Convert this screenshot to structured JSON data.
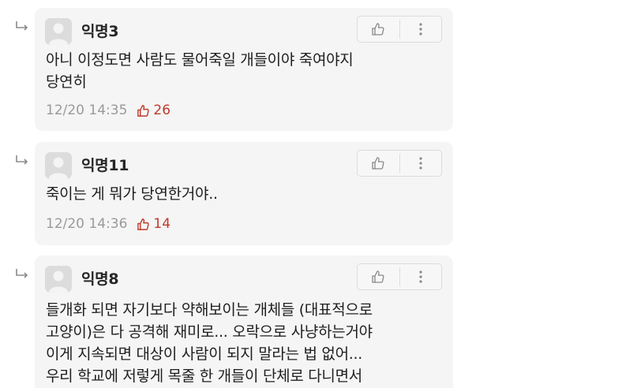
{
  "comments": [
    {
      "author": "익명3",
      "lines": [
        "아니 이정도면 사람도 물어죽일 개들이야 죽여야지",
        "당연히"
      ],
      "timestamp": "12/20 14:35",
      "likes": "26"
    },
    {
      "author": "익명11",
      "lines": [
        "죽이는 게 뭐가 당연한거야.."
      ],
      "timestamp": "12/20 14:36",
      "likes": "14"
    },
    {
      "author": "익명8",
      "lines": [
        "들개화 되면 자기보다 약해보이는 개체들 (대표적으로",
        "고양이)은 다 공격해 재미로... 오락으로 사냥하는거야",
        "이게 지속되면 대상이 사람이 되지 말라는 법 없어...",
        "우리 학교에 저렇게 목줄 한 개들이 단체로 다니면서"
      ],
      "timestamp": "",
      "likes": ""
    }
  ],
  "icons": {
    "reply": "reply-arrow-icon",
    "avatar": "default-avatar-icon",
    "like": "thumbs-up-icon",
    "more": "more-vertical-icon"
  },
  "colors": {
    "card_bg": "#f5f5f5",
    "like_red": "#c0392b",
    "meta_gray": "#9a9a9a"
  }
}
